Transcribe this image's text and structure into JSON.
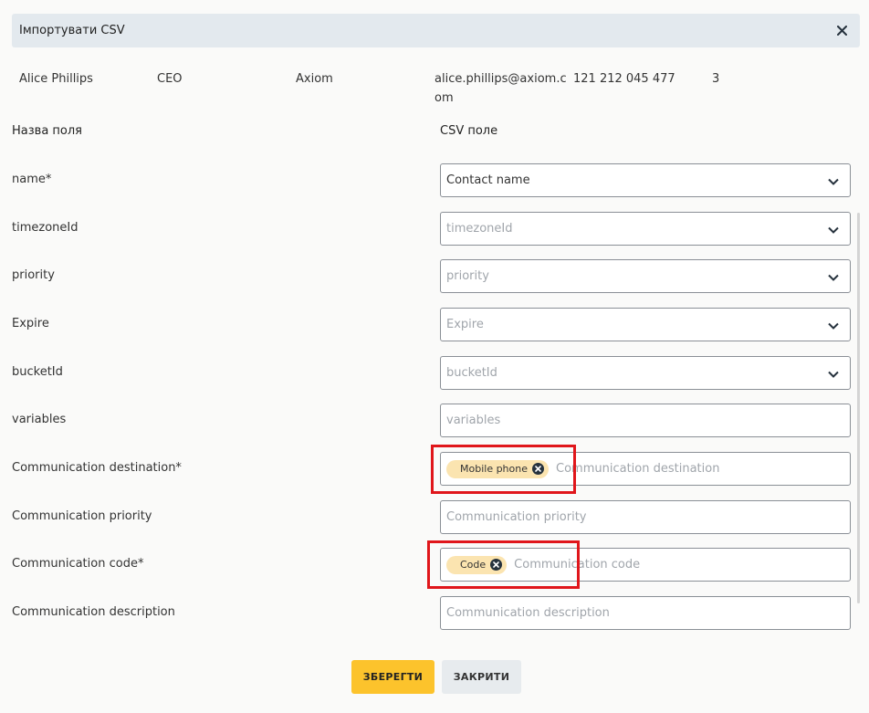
{
  "header": {
    "title": "Імпортувати CSV",
    "close_icon": "close-icon"
  },
  "preview_row": {
    "name": "Alice Phillips",
    "role": "CEO",
    "company": "Axiom",
    "email_line1": "alice.phillips@axiom.c",
    "email_line2": "om",
    "phone": "121 212 045 477",
    "count": "3"
  },
  "columns": {
    "field_name": "Назва поля",
    "csv_field": "CSV поле"
  },
  "rows": [
    {
      "label": "name*",
      "value": "Contact name",
      "placeholder": "",
      "dropdown": true
    },
    {
      "label": "timezoneId",
      "value": "",
      "placeholder": "timezoneId",
      "dropdown": true
    },
    {
      "label": "priority",
      "value": "",
      "placeholder": "priority",
      "dropdown": true
    },
    {
      "label": "Expire",
      "value": "",
      "placeholder": "Expire",
      "dropdown": true
    },
    {
      "label": "bucketId",
      "value": "",
      "placeholder": "bucketId",
      "dropdown": true
    },
    {
      "label": "variables",
      "value": "",
      "placeholder": "variables",
      "dropdown": false
    },
    {
      "label": "Communication destination*",
      "chip": "Mobile phone",
      "placeholder": "Communication destination",
      "dropdown": false
    },
    {
      "label": "Communication priority",
      "value": "",
      "placeholder": "Communication priority",
      "dropdown": false
    },
    {
      "label": "Communication code*",
      "chip": "Code",
      "placeholder": "Communication code",
      "dropdown": false
    },
    {
      "label": "Communication description",
      "value": "",
      "placeholder": "Communication description",
      "dropdown": false
    }
  ],
  "buttons": {
    "save": "ЗБЕРЕГТИ",
    "close": "ЗАКРИТИ"
  },
  "colors": {
    "accent": "#fcc32c",
    "chip": "#fbe4b0",
    "highlight": "#e0161b",
    "header_bg": "#e3e9ee"
  }
}
